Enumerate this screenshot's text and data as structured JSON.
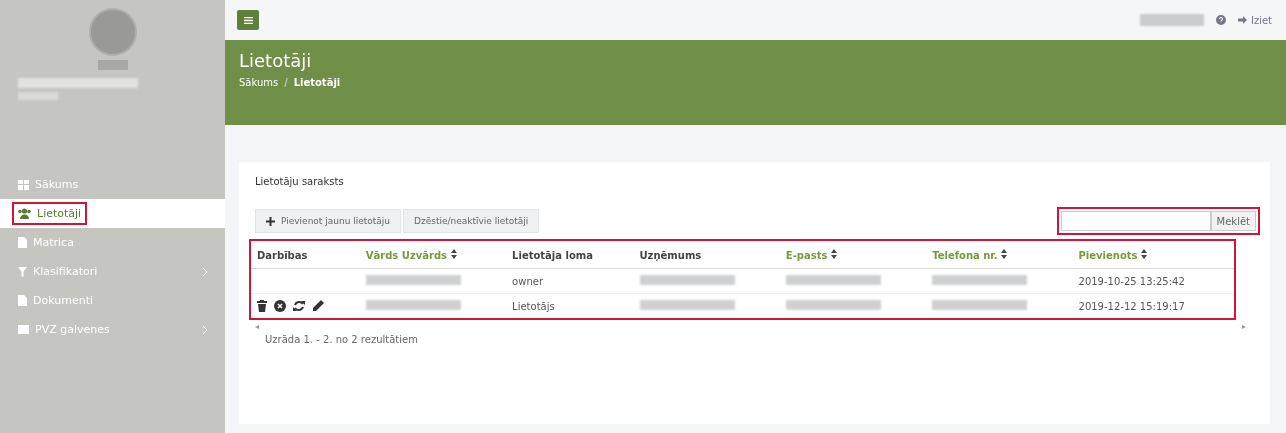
{
  "sidebar": {
    "logo": true,
    "organization_redacted": true,
    "items": [
      {
        "kind": "home",
        "label": "Sākums",
        "selected": false,
        "highlighted": false,
        "submenu": false
      },
      {
        "kind": "users",
        "label": "Lietotāji",
        "selected": true,
        "highlighted": true,
        "submenu": false
      },
      {
        "kind": "file",
        "label": "Matrica",
        "selected": false,
        "highlighted": false,
        "submenu": false
      },
      {
        "kind": "filter",
        "label": "Klasifikatori",
        "selected": false,
        "highlighted": false,
        "submenu": true
      },
      {
        "kind": "file",
        "label": "Dokumenti",
        "selected": false,
        "highlighted": false,
        "submenu": false
      },
      {
        "kind": "grid",
        "label": "PVZ galvenes",
        "selected": false,
        "highlighted": false,
        "submenu": true
      }
    ]
  },
  "topbar": {
    "user_redacted": true,
    "logout": "Iziet"
  },
  "header": {
    "title": "Lietotāji",
    "separator": "/",
    "breadcrumb": [
      {
        "label": "Sākums",
        "current": false
      },
      {
        "label": "Lietotāji",
        "current": true
      }
    ]
  },
  "card": {
    "title": "Lietotāju saraksts",
    "buttons": [
      {
        "label": "Pievienot jaunu lietotāju",
        "kind": "add"
      },
      {
        "label": "Dzēstie/neaktīvie lietotāji",
        "kind": "plain"
      }
    ],
    "search": {
      "button": "Meklēt",
      "highlighted": true
    },
    "table": {
      "highlighted": true,
      "columns": [
        {
          "label": "Darbības",
          "sortable": false
        },
        {
          "label": "Vārds Uzvārds",
          "sortable": true
        },
        {
          "label": "Lietotāja loma",
          "sortable": false
        },
        {
          "label": "Uzņēmums",
          "sortable": false
        },
        {
          "label": "E-pasts",
          "sortable": true
        },
        {
          "label": "Telefona nr.",
          "sortable": true
        },
        {
          "label": "Pievienots",
          "sortable": true
        }
      ],
      "rows": [
        {
          "actions": [],
          "cells": [
            {
              "kind": "redacted"
            },
            {
              "kind": "text",
              "text": "owner"
            },
            {
              "kind": "redacted"
            },
            {
              "kind": "redacted"
            },
            {
              "kind": "redacted"
            },
            {
              "kind": "text",
              "text": "2019-10-25 13:25:42"
            }
          ]
        },
        {
          "actions": [
            {
              "kind": "delete"
            },
            {
              "kind": "deactivate"
            },
            {
              "kind": "refresh"
            },
            {
              "kind": "edit"
            }
          ],
          "cells": [
            {
              "kind": "redacted"
            },
            {
              "kind": "text",
              "text": "Lietotājs"
            },
            {
              "kind": "redacted"
            },
            {
              "kind": "redacted"
            },
            {
              "kind": "redacted"
            },
            {
              "kind": "text",
              "text": "2019-12-12 15:19:17"
            }
          ]
        }
      ]
    },
    "footer": "Uzrāda 1. - 2. no 2 rezultātiem"
  }
}
